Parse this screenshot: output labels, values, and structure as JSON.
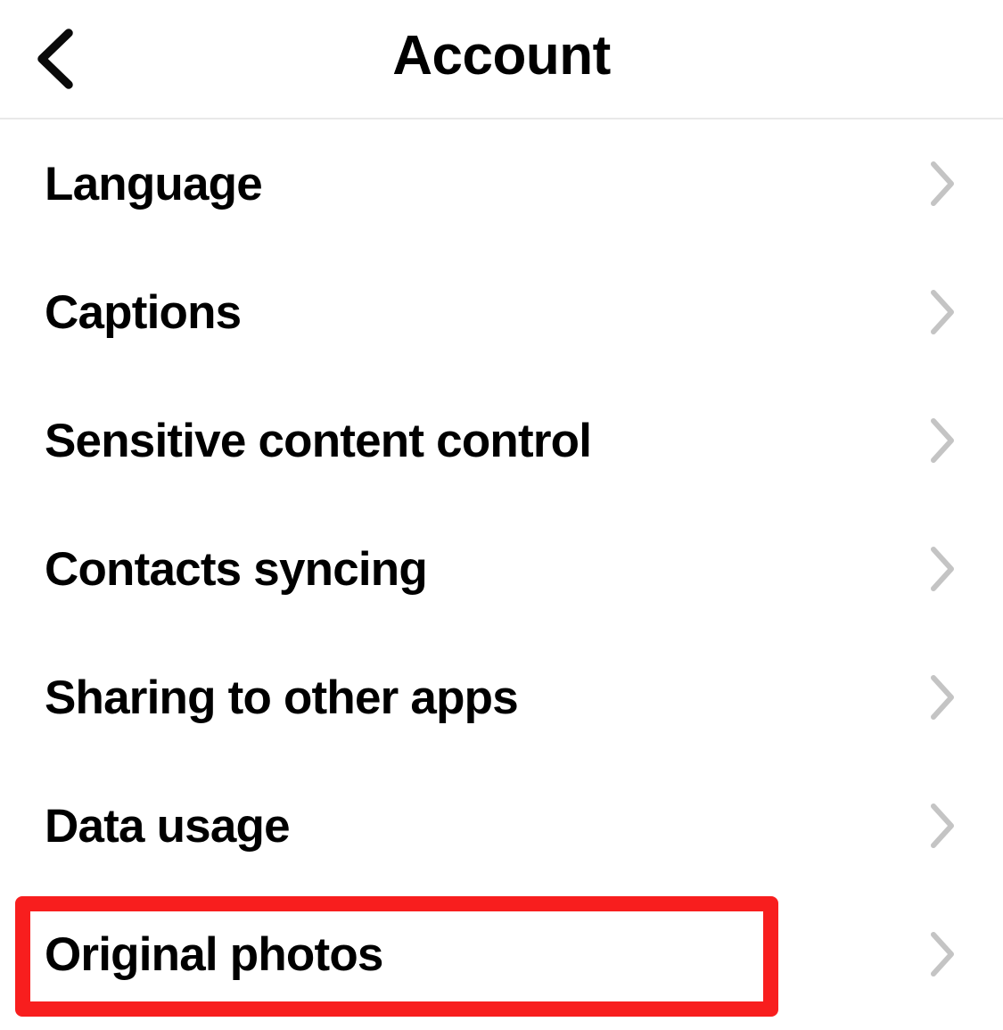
{
  "header": {
    "title": "Account",
    "back_icon": "chevron-left-icon"
  },
  "settings_list": {
    "chevron_icon": "chevron-right-icon",
    "items": [
      {
        "label": "Language"
      },
      {
        "label": "Captions"
      },
      {
        "label": "Sensitive content control"
      },
      {
        "label": "Contacts syncing"
      },
      {
        "label": "Sharing to other apps"
      },
      {
        "label": "Data usage"
      },
      {
        "label": "Original photos"
      }
    ]
  },
  "annotation": {
    "highlighted_item": "Original photos",
    "color": "#f81e1e"
  },
  "colors": {
    "background": "#ffffff",
    "text": "#000000",
    "chevron": "#c4c4c4",
    "divider": "#e9e9e9",
    "highlight": "#f81e1e"
  }
}
